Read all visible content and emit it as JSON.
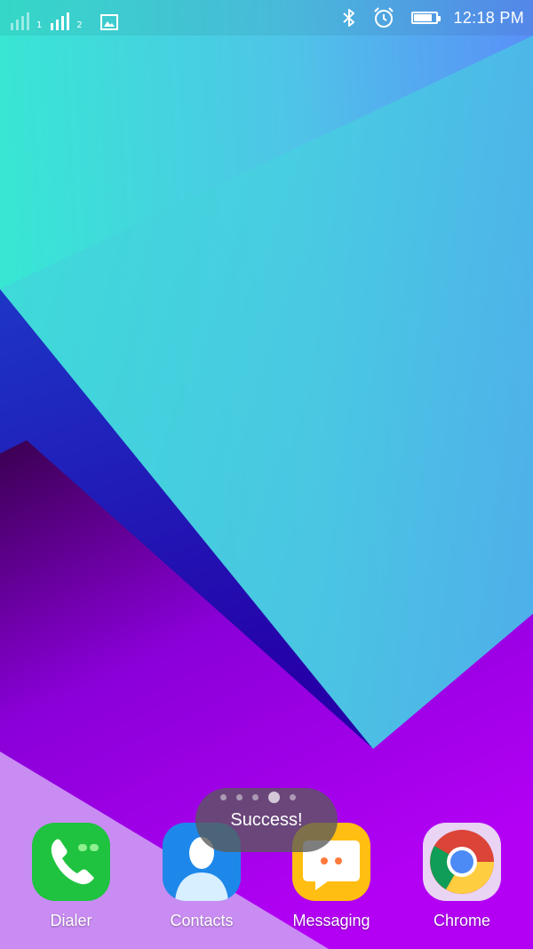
{
  "status_bar": {
    "sim1": "1",
    "sim2": "2",
    "time": "12:18 PM",
    "battery_level": 0.8,
    "icons": [
      "signal-sim1-icon",
      "signal-sim2-icon",
      "gallery-notification-icon",
      "bluetooth-icon",
      "alarm-icon",
      "battery-icon"
    ]
  },
  "dock": {
    "apps": [
      {
        "label": "Dialer",
        "icon": "phone-icon",
        "color": "#1fc33f"
      },
      {
        "label": "Contacts",
        "icon": "contacts-icon",
        "color": "#1e88ea"
      },
      {
        "label": "Messaging",
        "icon": "messaging-icon",
        "color": "#ffbe11"
      },
      {
        "label": "Chrome",
        "icon": "chrome-icon",
        "color": "#4c8bf5"
      }
    ]
  },
  "page_indicator": {
    "pages": 5,
    "active_index": 3
  },
  "toast": {
    "message": "Success!"
  }
}
